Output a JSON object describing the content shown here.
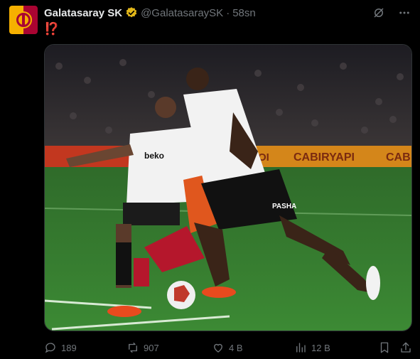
{
  "account": {
    "name": "Galatasaray SK",
    "handle": "@GalatasaraySK",
    "time": "58sn",
    "dot": "·"
  },
  "tweet": {
    "text": "⁉️"
  },
  "media": {
    "banner_left": "OI",
    "banner_main": "CABIRYAPI",
    "banner_right": "CAB",
    "shirt_sponsor": "beko",
    "shorts_sponsor": "PASHA"
  },
  "stats": {
    "replies": "189",
    "reposts": "907",
    "likes": "4 B",
    "views": "12 B"
  },
  "colors": {
    "background": "#000000",
    "muted": "#71767b",
    "text": "#e7e9ea",
    "verified_gold": "#e2b719",
    "accent_red": "#f4212e"
  }
}
